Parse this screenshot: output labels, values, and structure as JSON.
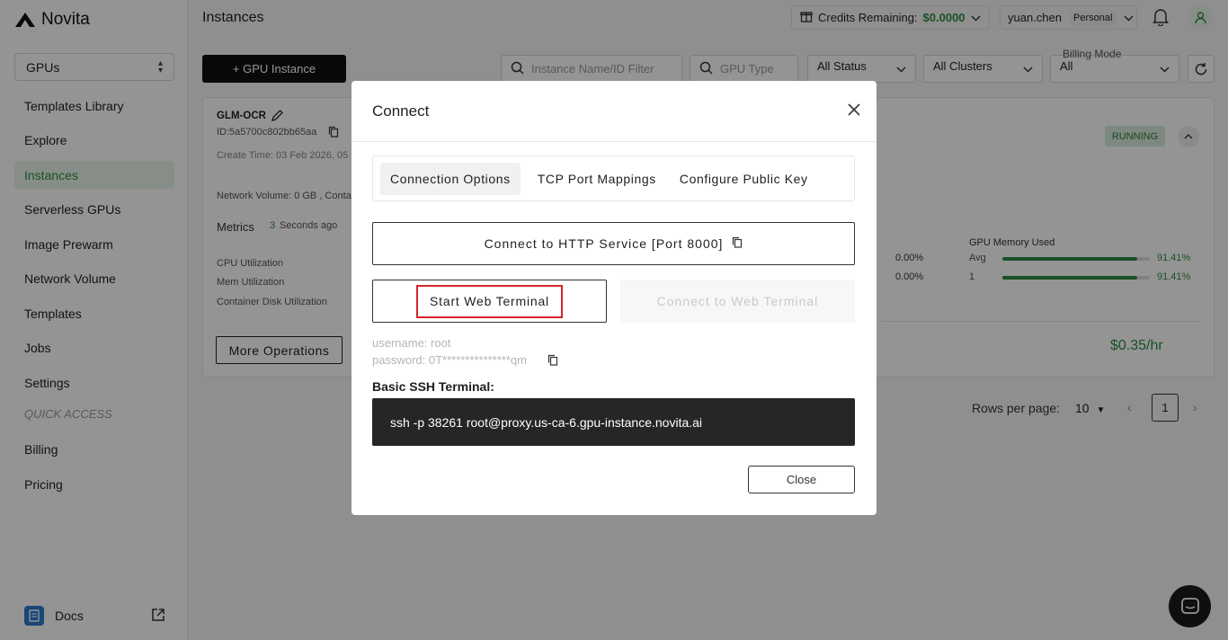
{
  "app": {
    "name": "Novita"
  },
  "sidebar": {
    "selector": "GPUs",
    "items": [
      {
        "label": "Templates Library"
      },
      {
        "label": "Explore"
      },
      {
        "label": "Instances"
      },
      {
        "label": "Serverless GPUs"
      },
      {
        "label": "Image Prewarm"
      },
      {
        "label": "Network Volume"
      },
      {
        "label": "Templates"
      },
      {
        "label": "Jobs"
      },
      {
        "label": "Settings"
      }
    ],
    "quick_access_label": "QUICK ACCESS",
    "quick_items": [
      {
        "label": "Billing"
      },
      {
        "label": "Pricing"
      }
    ],
    "docs_label": "Docs"
  },
  "header": {
    "title": "Instances",
    "credits_label": "Credits Remaining:",
    "credits_value": "$0.0000",
    "username": "yuan.chen",
    "account_type": "Personal"
  },
  "toolbar": {
    "new_instance": "+ GPU Instance",
    "name_filter_placeholder": "Instance Name/ID Filter",
    "gpu_type_placeholder": "GPU Type",
    "status_select": "All Status",
    "cluster_select": "All Clusters",
    "billing_label": "Billing Mode",
    "billing_value": "All"
  },
  "instance": {
    "name": "GLM-OCR",
    "id": "ID:5a5700c802bb65aa",
    "create_time": "Create Time: 03 Feb 2026, 05",
    "network_volume": "Network Volume: 0 GB , Conta",
    "metrics_label": "Metrics",
    "metrics_refresh": "3",
    "metrics_ago": "Seconds ago",
    "cpu_label": "CPU Utilization",
    "mem_label": "Mem Utilization",
    "disk_label": "Container Disk Utilization",
    "gpu_util_avg": "0.00%",
    "gpu_util_1": "0.00%",
    "gpu_mem_label": "GPU Memory Used",
    "gpu_mem_avg_label": "Avg",
    "gpu_mem_avg": "91.41%",
    "gpu_mem_avg_fraction": 0.914,
    "gpu_mem_1_label": "1",
    "gpu_mem_1": "91.41%",
    "gpu_mem_1_fraction": 0.914,
    "status": "RUNNING",
    "more_operations": "More Operations",
    "price": "$0.35/hr"
  },
  "pagination": {
    "rows_label": "Rows per page:",
    "rows_value": "10",
    "page": "1"
  },
  "modal": {
    "title": "Connect",
    "tabs": [
      {
        "label": "Connection Options"
      },
      {
        "label": "TCP Port Mappings"
      },
      {
        "label": "Configure Public Key"
      }
    ],
    "http_button": "Connect to HTTP Service [Port 8000]",
    "start_terminal": "Start Web Terminal",
    "connect_terminal": "Connect to Web Terminal",
    "username": "username: root",
    "password": "password: 0T***************qm",
    "ssh_label": "Basic SSH Terminal:",
    "ssh_command": "ssh -p 38261 root@proxy.us-ca-6.gpu-instance.novita.ai",
    "close_button": "Close"
  }
}
